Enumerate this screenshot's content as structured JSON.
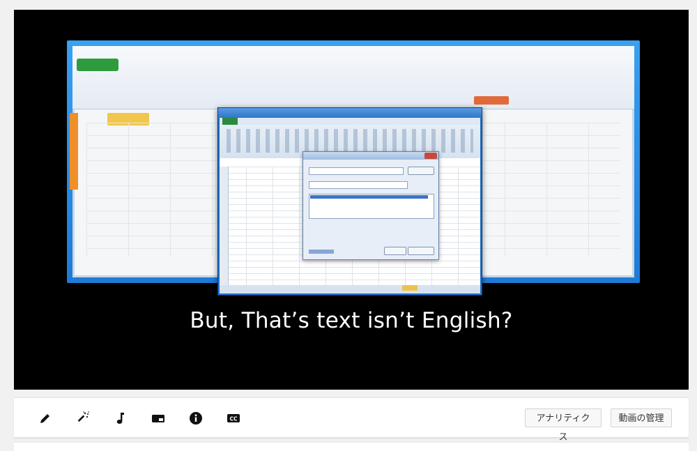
{
  "video": {
    "subtitle": "But, That’s text isn’t English?"
  },
  "toolbar": {
    "icons": [
      "pencil-icon",
      "magic-wand-icon",
      "music-note-icon",
      "card-icon",
      "info-icon",
      "cc-icon"
    ],
    "analytics_label": "アナリティクス",
    "manage_label": "動画の管理"
  },
  "colors": {
    "background": "#f1f1f1",
    "video_bg": "#000000",
    "frame_blue": "#1f7ad6",
    "excel_green": "#2b8a3e",
    "subtitle_text": "#ffffff"
  }
}
